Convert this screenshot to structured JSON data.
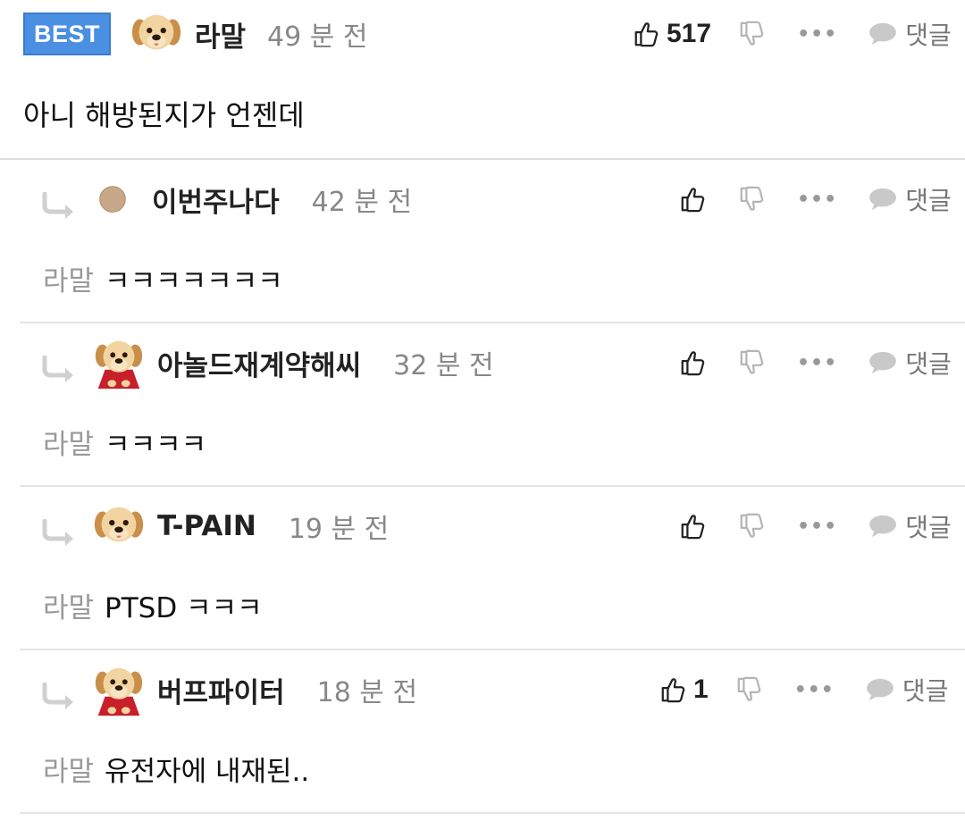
{
  "comments": [
    {
      "badge": "BEST",
      "nickname": "라말",
      "time": "49 분 전",
      "likes": "517",
      "reply_label": "댓글",
      "text": "아니 해방된지가 언젠데",
      "avatar": "puppy"
    },
    {
      "nickname": "이번주나다",
      "time": "42 분 전",
      "likes": "",
      "reply_label": "댓글",
      "mention": "라말",
      "text": "ㅋㅋㅋㅋㅋㅋㅋ",
      "avatar": "plain-circle"
    },
    {
      "nickname": "아놀드재계약해씨",
      "time": "32 분 전",
      "likes": "",
      "reply_label": "댓글",
      "mention": "라말",
      "text": "ㅋㅋㅋㅋ",
      "avatar": "puppy-cape"
    },
    {
      "nickname": "T-PAIN",
      "time": "19 분 전",
      "likes": "",
      "reply_label": "댓글",
      "mention": "라말",
      "text": "PTSD ㅋㅋㅋ",
      "avatar": "puppy"
    },
    {
      "nickname": "버프파이터",
      "time": "18 분 전",
      "likes": "1",
      "reply_label": "댓글",
      "mention": "라말",
      "text": "유전자에 내재된..",
      "avatar": "puppy-cape"
    }
  ],
  "icons": {
    "like": "thumbs-up-icon",
    "dislike": "thumbs-down-icon",
    "more": "more-icon",
    "reply": "speech-bubble-icon",
    "reply_arrow": "reply-arrow-icon"
  },
  "colors": {
    "best_badge": "#4a8fe2",
    "nickname": "#222222",
    "muted": "#888888",
    "divider": "#e4e4e4"
  }
}
